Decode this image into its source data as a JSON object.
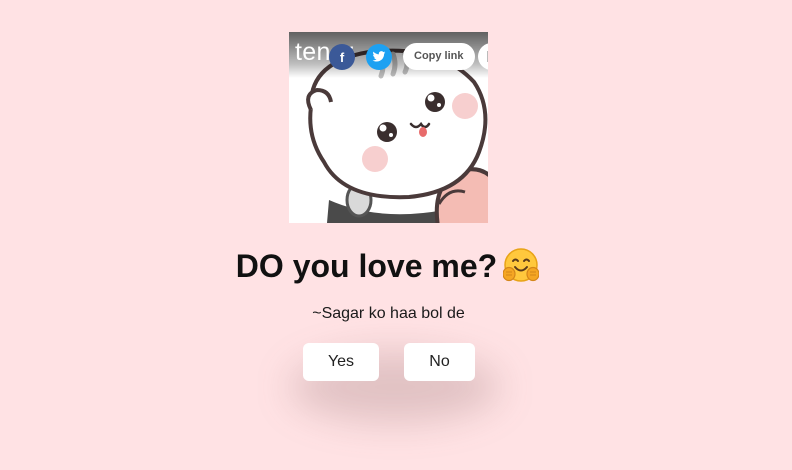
{
  "gif_embed": {
    "brand": "tenor",
    "share_facebook": "f",
    "copy_link_label": "Copy link",
    "image_icon": "cute-cat-gif"
  },
  "question": {
    "text": "DO you love me?",
    "emoji_icon": "hugging-face-emoji"
  },
  "subtitle": "~Sagar ko haa bol de",
  "buttons": {
    "yes_label": "Yes",
    "no_label": "No"
  },
  "colors": {
    "background": "#ffe2e4",
    "button_background": "#ffffff",
    "facebook": "#3b5998",
    "twitter": "#1da1f2"
  }
}
